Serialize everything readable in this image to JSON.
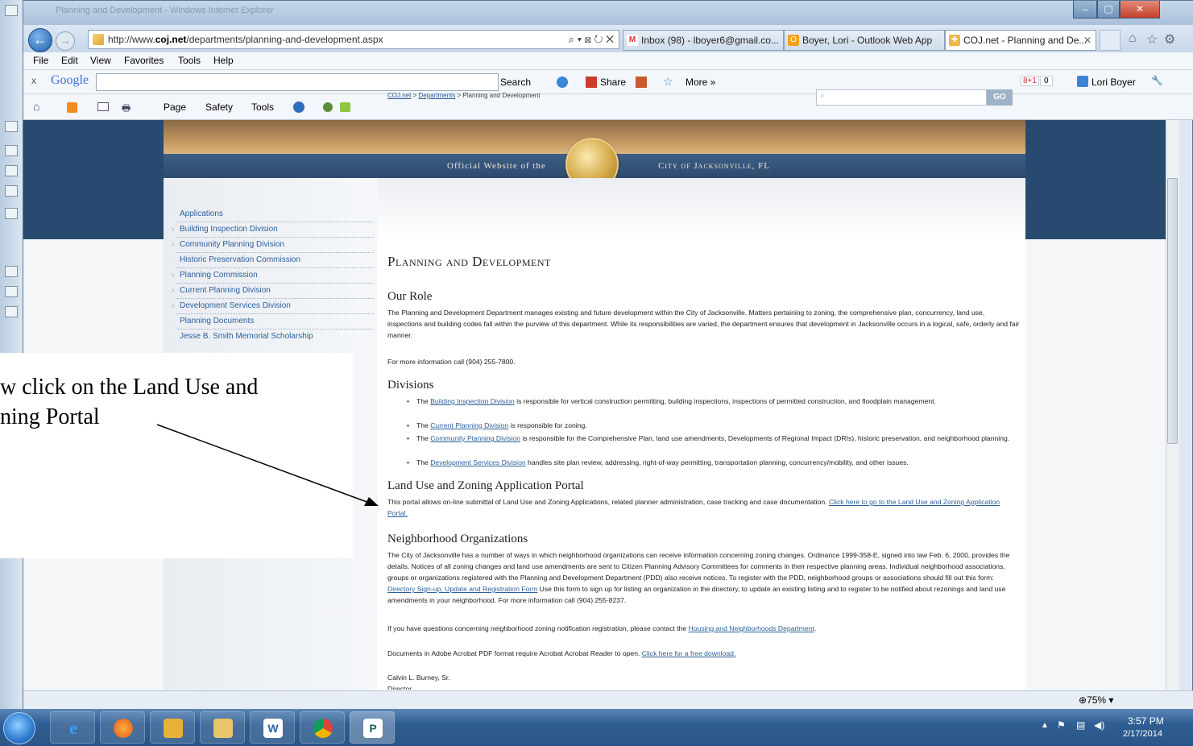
{
  "browser": {
    "window_title": "Planning and Development - Windows Internet Explorer",
    "address_prefix": "http://www.",
    "address_domain": "coj.net",
    "address_path": "/departments/planning-and-development.aspx",
    "address_controls": "⌕ ▾ ⊠ ↻ ✕",
    "tabs": [
      {
        "label": "Inbox (98) - lboyer6@gmail.co...",
        "icon": "M"
      },
      {
        "label": "Boyer, Lori - Outlook Web App",
        "icon": "O"
      },
      {
        "label": "COJ.net - Planning and De...",
        "icon": "✚",
        "close": "✕"
      }
    ],
    "menu": [
      "File",
      "Edit",
      "View",
      "Favorites",
      "Tools",
      "Help"
    ],
    "google_toolbar": {
      "logo": "Google",
      "close": "x",
      "search_label": "Search",
      "share_label": "Share",
      "more_label": "More »",
      "plus_count": "0",
      "plus_label": "8+1",
      "user_label": "Lori Boyer"
    },
    "command_bar": [
      "Page",
      "Safety",
      "Tools"
    ],
    "zoom": "75%"
  },
  "site": {
    "banner_left": "Official Website of the",
    "banner_right": "City of Jacksonville, FL",
    "sidebar": [
      {
        "label": "Applications",
        "arrow": false
      },
      {
        "label": "Building Inspection Division",
        "arrow": true
      },
      {
        "label": "Community Planning Division",
        "arrow": true
      },
      {
        "label": "Historic Preservation Commission",
        "arrow": false
      },
      {
        "label": "Planning Commission",
        "arrow": true
      },
      {
        "label": "Current Planning Division",
        "arrow": true
      },
      {
        "label": "Development Services Division",
        "arrow": true
      },
      {
        "label": "Planning Documents",
        "arrow": false
      },
      {
        "label": "Jesse B. Smith Memorial Scholarship",
        "arrow": false
      }
    ],
    "breadcrumb": {
      "home": "COJ.net",
      "sep": " > ",
      "dept": "Departments",
      "current": "Planning and Development"
    },
    "search_button": "GO",
    "page_title": "Planning and Development",
    "our_role": {
      "heading": "Our Role",
      "text": "The Planning and Development Department manages existing and future development within the City of Jacksonville. Matters pertaining to zoning, the comprehensive plan, concurrency, land use, inspections and building codes fall within the purview of this department. While its responsibilities are varied, the department ensures that development in Jacksonville occurs in a logical, safe, orderly and fair manner.",
      "phone": "For more information call (904) 255-7800."
    },
    "divisions": {
      "heading": "Divisions",
      "items": [
        {
          "pre": "The ",
          "link": "Building Inspection Division",
          "post": " is responsible for vertical construction permitting, building inspections, inspections of permitted construction, and floodplain management."
        },
        {
          "pre": "The ",
          "link": "Current Planning Division",
          "post": " is responsible for zoning."
        },
        {
          "pre": "The ",
          "link": "Community Planning Division",
          "post": " is responsible for the Comprehensive Plan, land use amendments, Developments of Regional Impact (DRIs), historic preservation, and neighborhood planning."
        },
        {
          "pre": "The ",
          "link": "Development Services Division",
          "post": " handles site plan review, addressing, right-of-way permitting, transportation planning, concurrency/mobility, and other issues."
        }
      ]
    },
    "portal": {
      "heading": "Land Use and Zoning Application Portal",
      "text": "This portal allows on-line submittal of Land Use and Zoning Applications, related planner administration, case tracking and case documentation. ",
      "link": "Click here to go to the Land Use and Zoning Application Portal."
    },
    "neighborhood": {
      "heading": "Neighborhood Organizations",
      "text1": "The City of Jacksonville has a number of ways in which neighborhood organizations can receive information concerning zoning changes. Ordinance 1999-358-E, signed into law Feb. 6, 2000, provides the details. Notices of all zoning changes and land use amendments are sent to Citizen Planning Advisory Committees for comments in their respective planning areas. Individual neighborhood associations, groups or organizations registered with the Planning and Development Department (PDD) also receive notices. To register with the PDD, neighborhood groups or associations should fill out this form: ",
      "link1": "Directory Sign-up, Update and Registration Form",
      "text2": "  Use this form to sign up for listing an organization in the directory, to update an existing listing and to register to be notified about rezonings and land use amendments in your neighborhood. For more information call (904) 255-8237.",
      "contact_pre": "If you have questions concerning neighborhood zoning notification registration, please contact the ",
      "contact_link": "Housing and Neighborhoods Department",
      "contact_post": ".",
      "pdf_pre": "Documents in Adobe Acrobat PDF format require Acrobat Acrobat Reader to open. ",
      "pdf_link": "Click here for a free download.",
      "director_name": "Calvin L. Burney, Sr.",
      "director_title": "Director"
    }
  },
  "annotation": {
    "line1": "w click on the Land Use and",
    "line2": "ning Portal"
  },
  "taskbar": {
    "time": "3:57 PM",
    "date": "2/17/2014"
  }
}
